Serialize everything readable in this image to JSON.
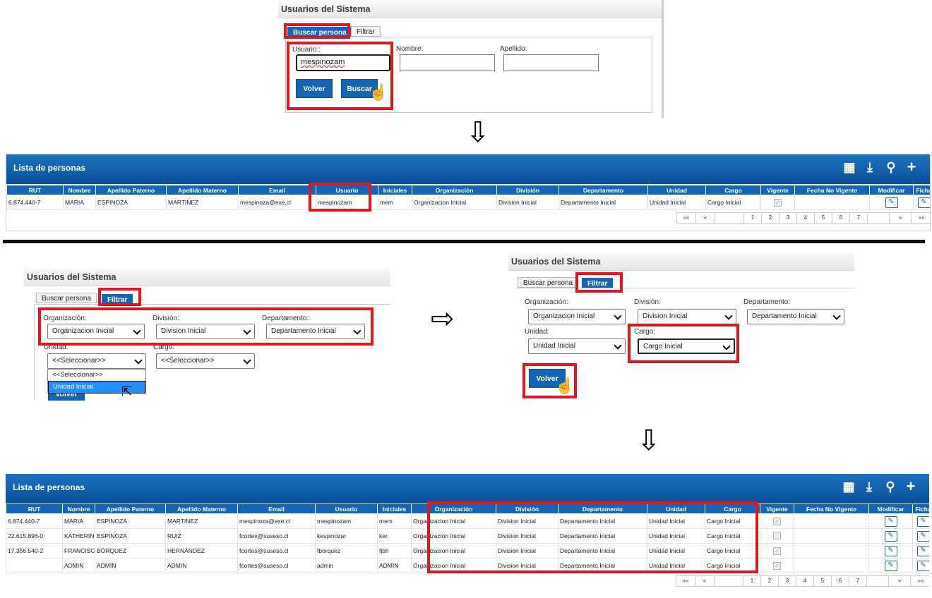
{
  "panel1": {
    "title": "Usuarios del Sistema",
    "tab_buscar": "Buscar persona",
    "tab_filtrar": "Filtrar",
    "usuario_label": "Usuario::",
    "usuario_value": "mespinozam",
    "nombre_label": "Nombre:",
    "apellido_label": "Apellido:",
    "volver": "Volver",
    "buscar": "Buscar"
  },
  "list1": {
    "title": "Lista de personas",
    "headers": [
      "RUT",
      "Nombre",
      "Apellido Paterno",
      "Apellido Materno",
      "Email",
      "Usuario",
      "Iniciales",
      "Organización",
      "División",
      "Departamento",
      "Unidad",
      "Cargo",
      "Vigente",
      "Fecha No Vigente",
      "Modificar",
      "Ficha"
    ],
    "rows": [
      [
        "6.874.440-7",
        "MARIA",
        "ESPINOZA",
        "MARTINEZ",
        "mespinoza@exe.cl",
        "mespinozam",
        "mem",
        "Organizacion Inicial",
        "Division Inicial",
        "Departamento Inicial",
        "Unidad Inicial",
        "Cargo Inicial"
      ]
    ]
  },
  "panel2": {
    "title": "Usuarios del Sistema",
    "tab_buscar": "Buscar persona",
    "tab_filtrar": "Filtrar",
    "org_label": "Organización:",
    "org_value": "Organizacion Inicial",
    "div_label": "División:",
    "div_value": "Division Inicial",
    "dep_label": "Departamento:",
    "dep_value": "Departamento Inicial",
    "unidad_label": "Unidad:",
    "unidad_value": "<<Seleccionar>>",
    "cargo_label": "Cargo:",
    "cargo_value": "<<Seleccionar>>",
    "dropdown_options": [
      "<<Seleccionar>>",
      "Unidad Inicial"
    ],
    "volver": "Volver"
  },
  "panel3": {
    "title": "Usuarios del Sistema",
    "tab_buscar": "Buscar persona",
    "tab_filtrar": "Filtrar",
    "org_label": "Organización:",
    "org_value": "Organizacion Inicial",
    "div_label": "División:",
    "div_value": "Division Inicial",
    "dep_label": "Departamento:",
    "dep_value": "Departamento Inicial",
    "unidad_label": "Unidad:",
    "unidad_value": "Unidad Inicial",
    "cargo_label": "Cargo:",
    "cargo_value": "Cargo Inicial",
    "volver": "Volver"
  },
  "list2": {
    "title": "Lista de personas",
    "headers": [
      "RUT",
      "Nombre",
      "Apellido Paterno",
      "Apellido Materno",
      "Email",
      "Usuario",
      "Iniciales",
      "Organización",
      "División",
      "Departamento",
      "Unidad",
      "Cargo",
      "Vigente",
      "Fecha No Vigente",
      "Modificar",
      "Ficha"
    ],
    "rows": [
      [
        "6.874.440-7",
        "MARIA",
        "ESPINOZA",
        "MARTINEZ",
        "mespinoza@exe.cl",
        "mespinozam",
        "mem",
        "Organizacion Inicial",
        "Division Inicial",
        "Departamento Inicial",
        "Unidad Inicial",
        "Cargo Inicial"
      ],
      [
        "22.615.896-0",
        "KATHERINE",
        "ESPINOZA",
        "RUIZ",
        "fcortes@suseso.cl",
        "kespinozar",
        "ker",
        "Organizacion Inicial",
        "Division Inicial",
        "Departamento Inicial",
        "Unidad Inicial",
        "Cargo Inicial"
      ],
      [
        "17.356.540-2",
        "FRANCISCO JOSÉ",
        "BÓRQUEZ",
        "HERNÁNDEZ",
        "fcortes@suseso.cl",
        "fborquez",
        "fjbh",
        "Organizacion Inicial",
        "Division Inicial",
        "Departamento Inicial",
        "Unidad Inicial",
        "Cargo Inicial"
      ],
      [
        "",
        "ADMIN",
        "ADMIN",
        "ADMIN",
        "fcortes@suseso.cl",
        "admin",
        "ADMIN",
        "Organizacion Inicial",
        "Division Inicial",
        "Departamento Inicial",
        "Unidad Inicial",
        "Cargo Inicial"
      ]
    ],
    "vigente": [
      true,
      false,
      true,
      true
    ]
  },
  "pager": [
    "««",
    "«",
    "",
    "1",
    "2",
    "3",
    "4",
    "5",
    "6",
    "7",
    "",
    "»",
    "»»"
  ],
  "icons": {
    "grid": "grid-icon",
    "download": "download-icon",
    "search": "search-icon",
    "add": "plus-icon",
    "edit": "edit-icon",
    "flow_down": "arrow-down-icon",
    "flow_right": "arrow-right-icon",
    "cursor": "hand-cursor-icon"
  },
  "colors": {
    "primary": "#1565b5",
    "highlight": "#e3161e"
  }
}
